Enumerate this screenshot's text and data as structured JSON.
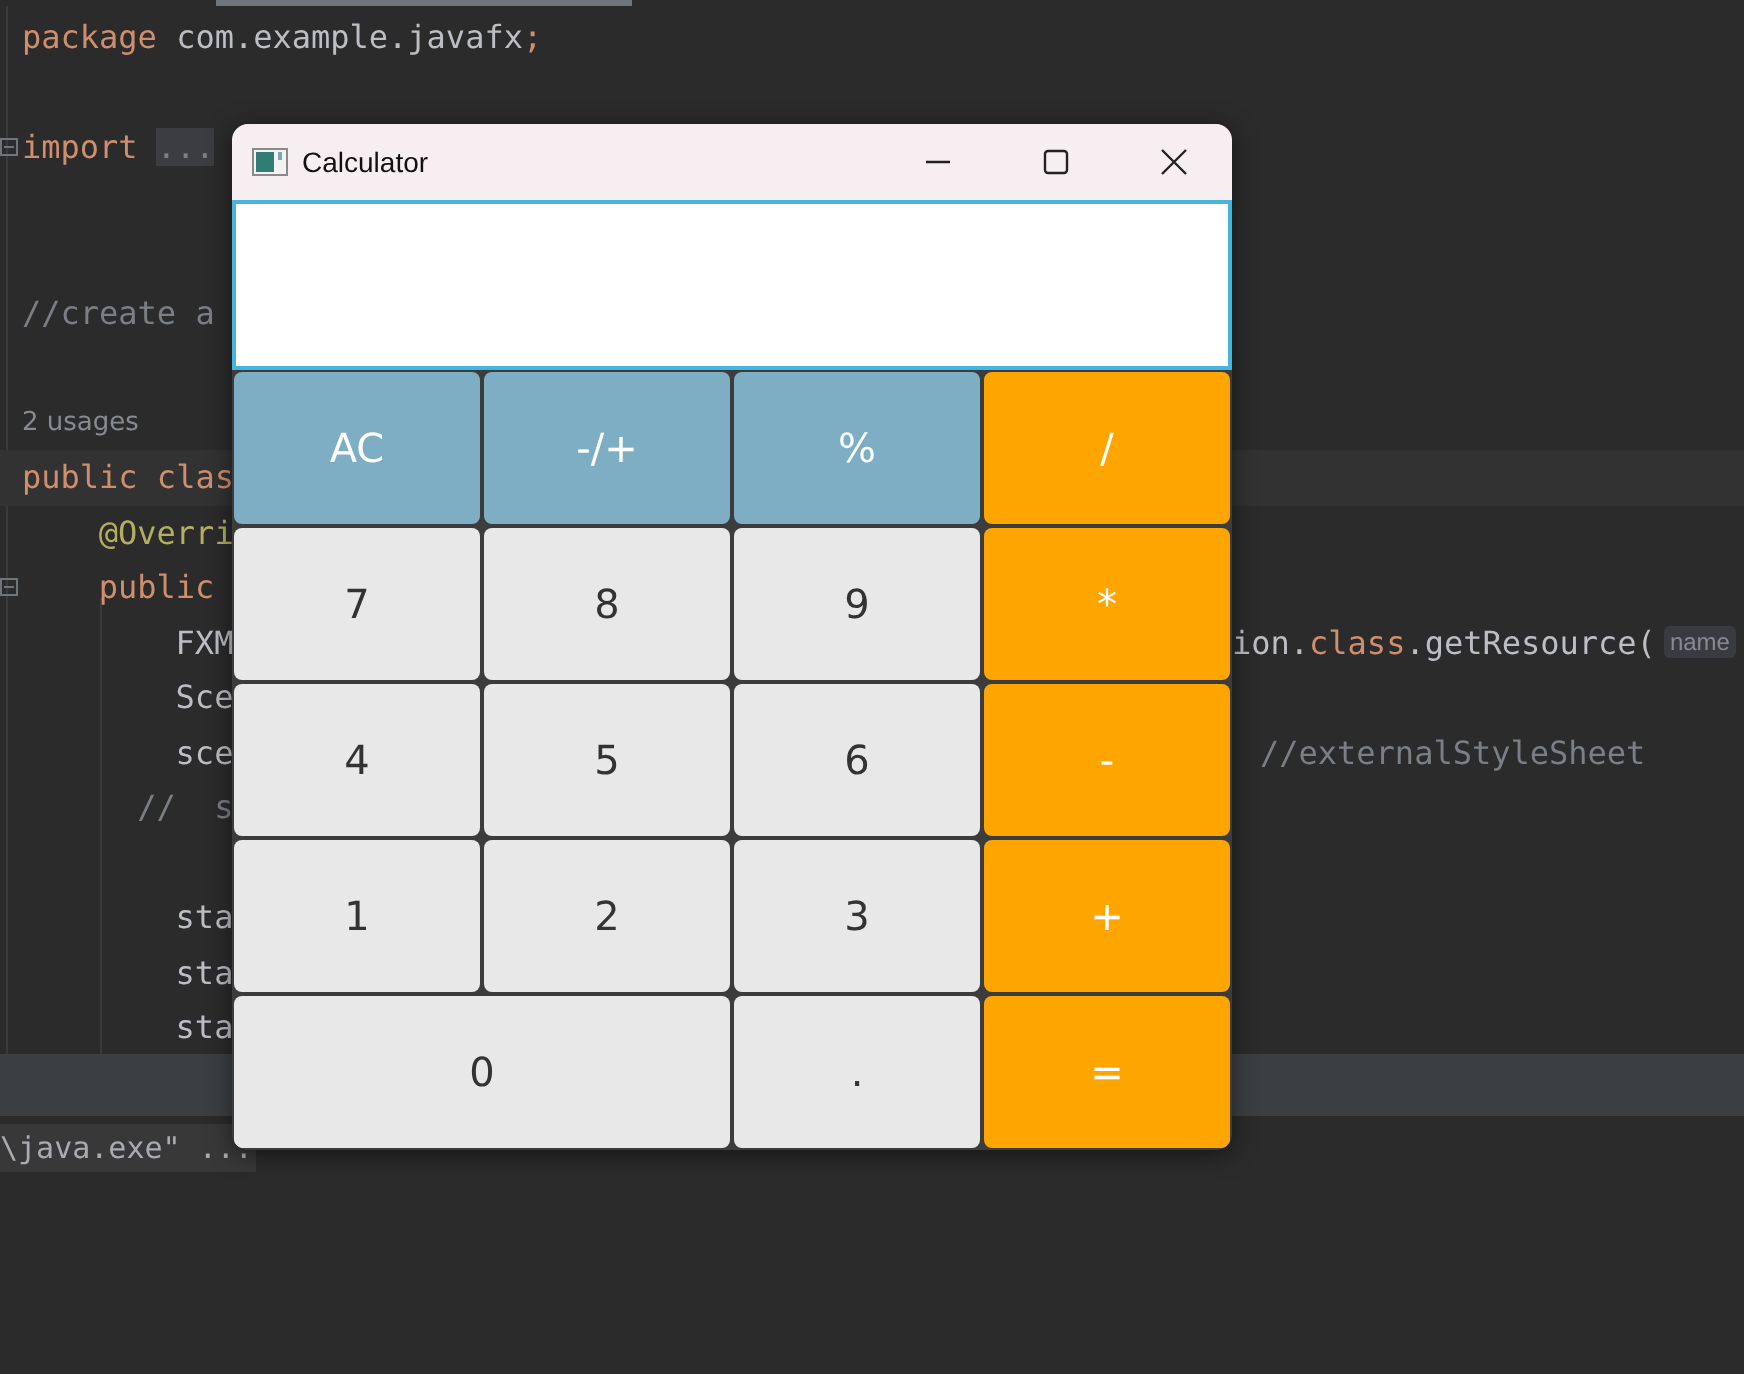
{
  "editor": {
    "lines": [
      {
        "kind": "top",
        "left": [
          {
            "text": "package",
            "kind": "keyword"
          },
          {
            "text": " com.example.javafx",
            "kind": "plain"
          },
          {
            "text": ";",
            "kind": "keyword"
          }
        ]
      },
      {
        "kind": "top"
      },
      {
        "kind": "top",
        "fold": true,
        "left": [
          {
            "text": "import",
            "kind": "keyword"
          },
          {
            "text": "...",
            "kind": "folded"
          }
        ]
      },
      {
        "kind": "top"
      },
      {
        "kind": "top"
      },
      {
        "kind": "top",
        "left": [
          {
            "text": "//create a",
            "kind": "comment"
          }
        ]
      },
      {
        "kind": "top"
      },
      {
        "kind": "top",
        "left": [
          {
            "text": "2 usages",
            "kind": "usages"
          }
        ]
      },
      {
        "kind": "top",
        "current": true,
        "left": [
          {
            "text": "public clas",
            "kind": "keyword"
          }
        ]
      },
      {
        "kind": "member",
        "left": [
          {
            "text": "@Overri",
            "kind": "annotation"
          }
        ]
      },
      {
        "kind": "member",
        "fold": true,
        "left": [
          {
            "text": "public",
            "kind": "keyword"
          }
        ]
      },
      {
        "kind": "body",
        "left": [
          {
            "text": "FXM",
            "kind": "plain"
          }
        ],
        "right": [
          {
            "text": "ion.",
            "kind": "plain"
          },
          {
            "text": "class",
            "kind": "keyword"
          },
          {
            "text": ".getResource(",
            "kind": "plain"
          },
          {
            "text": "name",
            "kind": "hint"
          }
        ]
      },
      {
        "kind": "body",
        "left": [
          {
            "text": "Sce",
            "kind": "plain"
          }
        ]
      },
      {
        "kind": "body",
        "left": [
          {
            "text": "sce",
            "kind": "plain"
          }
        ],
        "right": [
          {
            "text": "//externalStyleSheet",
            "kind": "comment"
          }
        ]
      },
      {
        "kind": "disabled",
        "left": [
          {
            "text": "//  s",
            "kind": "comment"
          }
        ]
      },
      {
        "kind": "top"
      },
      {
        "kind": "body",
        "left": [
          {
            "text": "sta",
            "kind": "plain"
          }
        ]
      },
      {
        "kind": "body",
        "left": [
          {
            "text": "sta",
            "kind": "plain"
          }
        ]
      },
      {
        "kind": "body",
        "left": [
          {
            "text": "sta",
            "kind": "plain"
          }
        ]
      }
    ]
  },
  "console": {
    "text": "\\java.exe\" ..."
  },
  "calculator": {
    "title": "Calculator",
    "buttons": [
      {
        "label": "AC",
        "kind": "function"
      },
      {
        "label": "-/+",
        "kind": "function"
      },
      {
        "label": "%",
        "kind": "function"
      },
      {
        "label": "/",
        "kind": "operator"
      },
      {
        "label": "7",
        "kind": "digit"
      },
      {
        "label": "8",
        "kind": "digit"
      },
      {
        "label": "9",
        "kind": "digit"
      },
      {
        "label": "*",
        "kind": "operator"
      },
      {
        "label": "4",
        "kind": "digit"
      },
      {
        "label": "5",
        "kind": "digit"
      },
      {
        "label": "6",
        "kind": "digit"
      },
      {
        "label": "-",
        "kind": "operator"
      },
      {
        "label": "1",
        "kind": "digit"
      },
      {
        "label": "2",
        "kind": "digit"
      },
      {
        "label": "3",
        "kind": "digit"
      },
      {
        "label": "+",
        "kind": "operator"
      },
      {
        "label": "0",
        "kind": "digit",
        "wide": true
      },
      {
        "label": ".",
        "kind": "digit"
      },
      {
        "label": "=",
        "kind": "operator"
      }
    ]
  }
}
